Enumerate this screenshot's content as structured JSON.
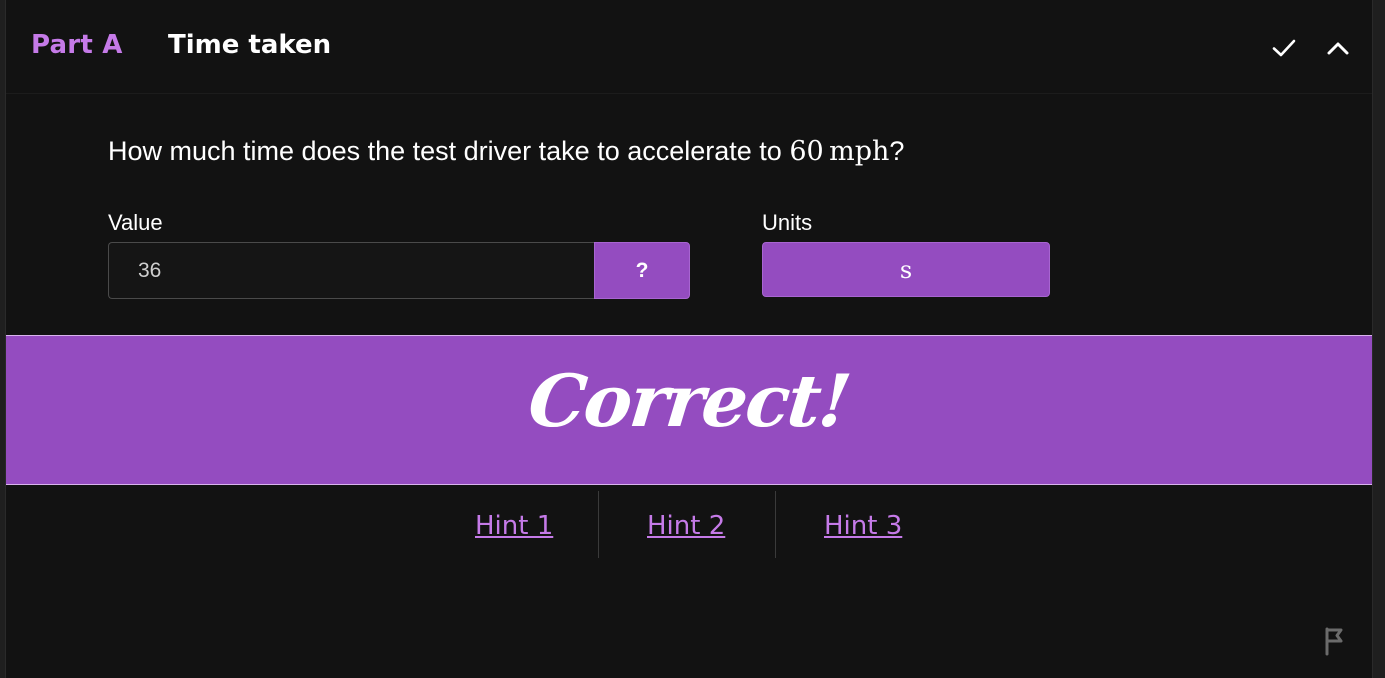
{
  "header": {
    "part_label": "Part A",
    "title": "Time taken"
  },
  "question": {
    "text_before": "How much time does the test driver take to accelerate to ",
    "math_value": "60",
    "math_unit": "mph",
    "text_after": "?"
  },
  "answer": {
    "value_label": "Value",
    "value": "36",
    "help_label": "?",
    "units_label": "Units",
    "units_value": "s"
  },
  "feedback": {
    "message": "Correct!"
  },
  "hints": [
    {
      "label": "Hint 1"
    },
    {
      "label": "Hint 2"
    },
    {
      "label": "Hint 3"
    }
  ],
  "colors": {
    "accent": "#944cc0",
    "accent_text": "#c57ae8",
    "background": "#121212"
  },
  "icons": {
    "header_check": "check-icon",
    "header_collapse": "chevron-up-icon",
    "report": "flag-icon"
  }
}
